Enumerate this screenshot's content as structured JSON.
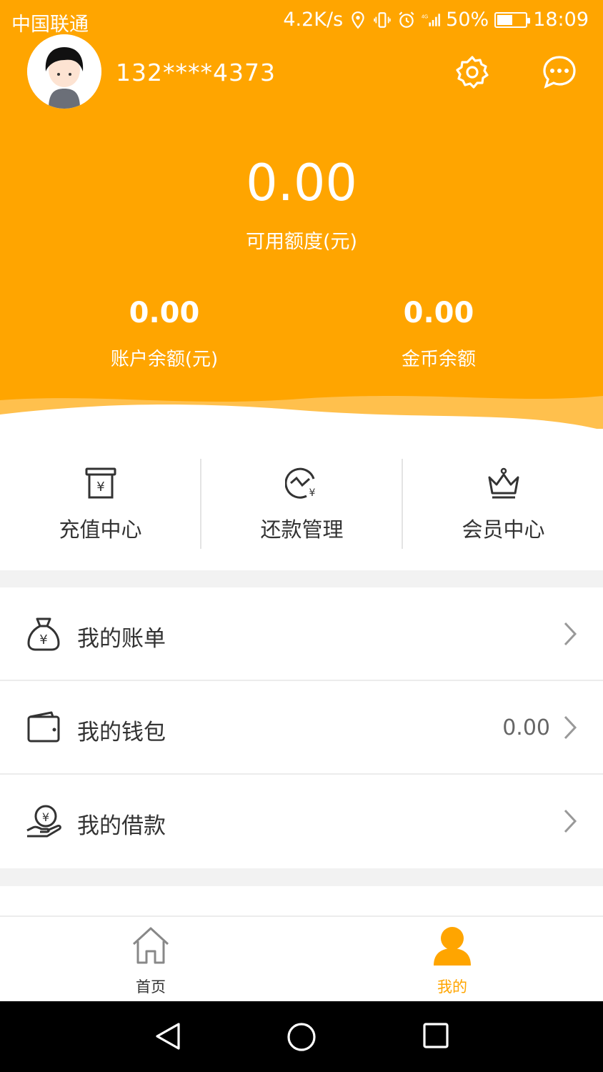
{
  "status_bar": {
    "carrier": "中国联通",
    "speed": "4.2K/s",
    "battery": "50%",
    "time": "18:09"
  },
  "profile": {
    "phone": "132****4373"
  },
  "balance": {
    "available_amount": "0.00",
    "available_label": "可用额度(元)",
    "account_amount": "0.00",
    "account_label": "账户余额(元)",
    "coin_amount": "0.00",
    "coin_label": "金币余额"
  },
  "quick_actions": [
    {
      "label": "充值中心",
      "icon": "recharge-icon"
    },
    {
      "label": "还款管理",
      "icon": "repayment-icon"
    },
    {
      "label": "会员中心",
      "icon": "crown-icon"
    }
  ],
  "menu": [
    {
      "label": "我的账单",
      "icon": "money-bag-icon",
      "value": ""
    },
    {
      "label": "我的钱包",
      "icon": "wallet-icon",
      "value": "0.00"
    },
    {
      "label": "我的借款",
      "icon": "loan-hand-icon",
      "value": ""
    }
  ],
  "bottom_nav": [
    {
      "label": "首页",
      "icon": "home-icon",
      "active": false
    },
    {
      "label": "我的",
      "icon": "user-icon",
      "active": true
    }
  ],
  "colors": {
    "accent": "#ffa500",
    "inactive": "#888888",
    "text": "#333333"
  }
}
